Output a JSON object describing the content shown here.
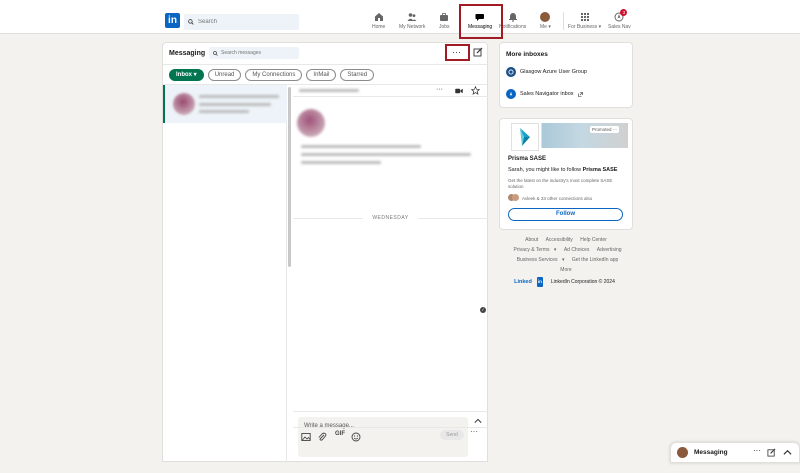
{
  "nav": {
    "search_placeholder": "Search",
    "items": [
      {
        "label": "Home",
        "icon": "home-icon"
      },
      {
        "label": "My Network",
        "icon": "network-icon"
      },
      {
        "label": "Jobs",
        "icon": "briefcase-icon"
      },
      {
        "label": "Messaging",
        "icon": "messaging-icon",
        "active": true
      },
      {
        "label": "Notifications",
        "icon": "bell-icon"
      },
      {
        "label": "Me",
        "icon": "avatar"
      },
      {
        "label": "For Business",
        "icon": "grid-icon"
      },
      {
        "label": "Sales Nav",
        "icon": "sales-nav-icon",
        "badge": "3"
      }
    ]
  },
  "messaging": {
    "title": "Messaging",
    "search_placeholder": "Search messages",
    "more_label": "···",
    "filters": [
      "Inbox",
      "Unread",
      "My Connections",
      "InMail",
      "Starred"
    ],
    "day_divider": "WEDNESDAY",
    "compose_placeholder": "Write a message...",
    "gif_label": "GIF",
    "send_label": "Send"
  },
  "more_inboxes": {
    "title": "More inboxes",
    "items": [
      {
        "label": "Glasgow Azure User Group"
      },
      {
        "label": "Sales Navigator inbox"
      }
    ]
  },
  "ad": {
    "promoted": "Promoted",
    "name": "Prisma SASE",
    "line_prefix": "Sarah, you might like to follow ",
    "line_brand": "Prisma SASE",
    "description": "Get the latest on the industry's most complete SASE solution",
    "connections": "Avleek & 33 other connections also",
    "follow_label": "Follow"
  },
  "footer": {
    "row1": [
      "About",
      "Accessibility",
      "Help Center"
    ],
    "row2": [
      "Privacy & Terms",
      "Ad Choices",
      "Advertising"
    ],
    "row3": [
      "Business Services",
      "Get the LinkedIn app"
    ],
    "row4": "More",
    "brand_word": "Linked",
    "brand_in": "in",
    "copyright": "LinkedIn Corporation © 2024"
  },
  "dock": {
    "title": "Messaging"
  },
  "colors": {
    "brand": "#0a66c2",
    "inbox_green": "#01754f",
    "highlight": "#a11b24"
  }
}
